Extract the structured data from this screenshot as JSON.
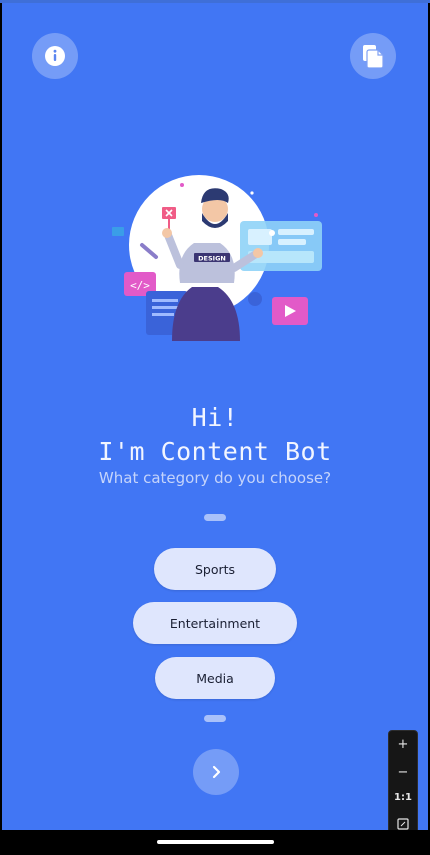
{
  "header": {
    "info_icon": "info-icon",
    "copy_icon": "copy-icon"
  },
  "greeting": {
    "line1": "Hi!",
    "line2": "I'm Content Bot",
    "prompt": "What category do you choose?"
  },
  "illustration": {
    "badge_text": "DESIGN"
  },
  "options": [
    {
      "label": "Sports"
    },
    {
      "label": "Entertainment"
    },
    {
      "label": "Media"
    }
  ],
  "next_icon": "chevron-right-icon",
  "zoom_controls": {
    "zoom_in": "+",
    "zoom_out": "−",
    "reset": "1:1",
    "fit_icon": "fit-screen-icon"
  },
  "colors": {
    "background": "#4176f4",
    "option_fill": "#dfe6fd",
    "button_fill": "rgba(255,255,255,0.28)"
  }
}
